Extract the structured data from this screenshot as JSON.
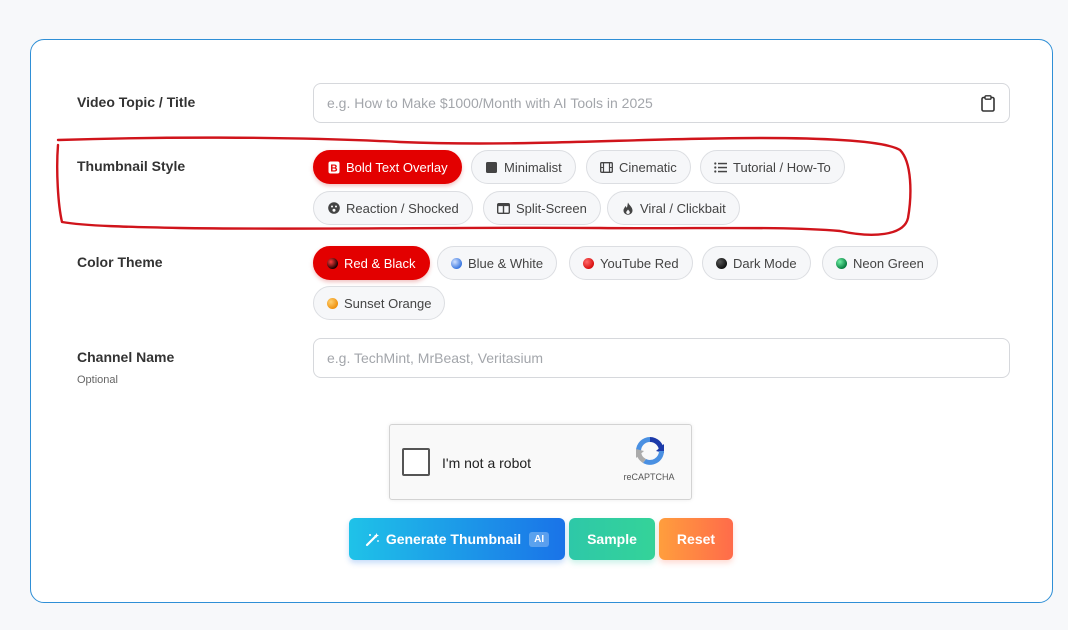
{
  "form": {
    "video_topic": {
      "label": "Video Topic / Title",
      "value": "",
      "placeholder": "e.g. How to Make $1000/Month with AI Tools in 2025"
    },
    "thumbnail_style": {
      "label": "Thumbnail Style",
      "options": [
        {
          "label": "Bold Text Overlay",
          "icon": "bold-b-icon",
          "selected": true
        },
        {
          "label": "Minimalist",
          "icon": "square-icon",
          "selected": false
        },
        {
          "label": "Cinematic",
          "icon": "film-icon",
          "selected": false
        },
        {
          "label": "Tutorial / How-To",
          "icon": "list-icon",
          "selected": false
        },
        {
          "label": "Reaction / Shocked",
          "icon": "shocked-face-icon",
          "selected": false
        },
        {
          "label": "Split-Screen",
          "icon": "split-screen-icon",
          "selected": false
        },
        {
          "label": "Viral / Clickbait",
          "icon": "fire-icon",
          "selected": false
        }
      ]
    },
    "color_theme": {
      "label": "Color Theme",
      "options": [
        {
          "label": "Red & Black",
          "dot_color": "#1a0000",
          "selected": true
        },
        {
          "label": "Blue & White",
          "dot_color": "#5b8fe0",
          "selected": false
        },
        {
          "label": "YouTube Red",
          "dot_color": "#e52a2a",
          "selected": false
        },
        {
          "label": "Dark Mode",
          "dot_color": "#2a2a2a",
          "selected": false
        },
        {
          "label": "Neon Green",
          "dot_color": "#0f9a4a",
          "selected": false
        },
        {
          "label": "Sunset Orange",
          "dot_color": "#f0a020",
          "selected": false
        }
      ]
    },
    "channel_name": {
      "label": "Channel Name",
      "sublabel": "Optional",
      "value": "",
      "placeholder": "e.g. TechMint, MrBeast, Veritasium"
    }
  },
  "recaptcha": {
    "label": "I'm not a robot",
    "brand": "reCAPTCHA"
  },
  "actions": {
    "generate_label": "Generate Thumbnail",
    "ai_badge": "AI",
    "sample_label": "Sample",
    "reset_label": "Reset"
  },
  "colors": {
    "card_border": "#2f8fd6",
    "accent_red": "#e30000",
    "annotation_stroke": "#d0141b"
  }
}
